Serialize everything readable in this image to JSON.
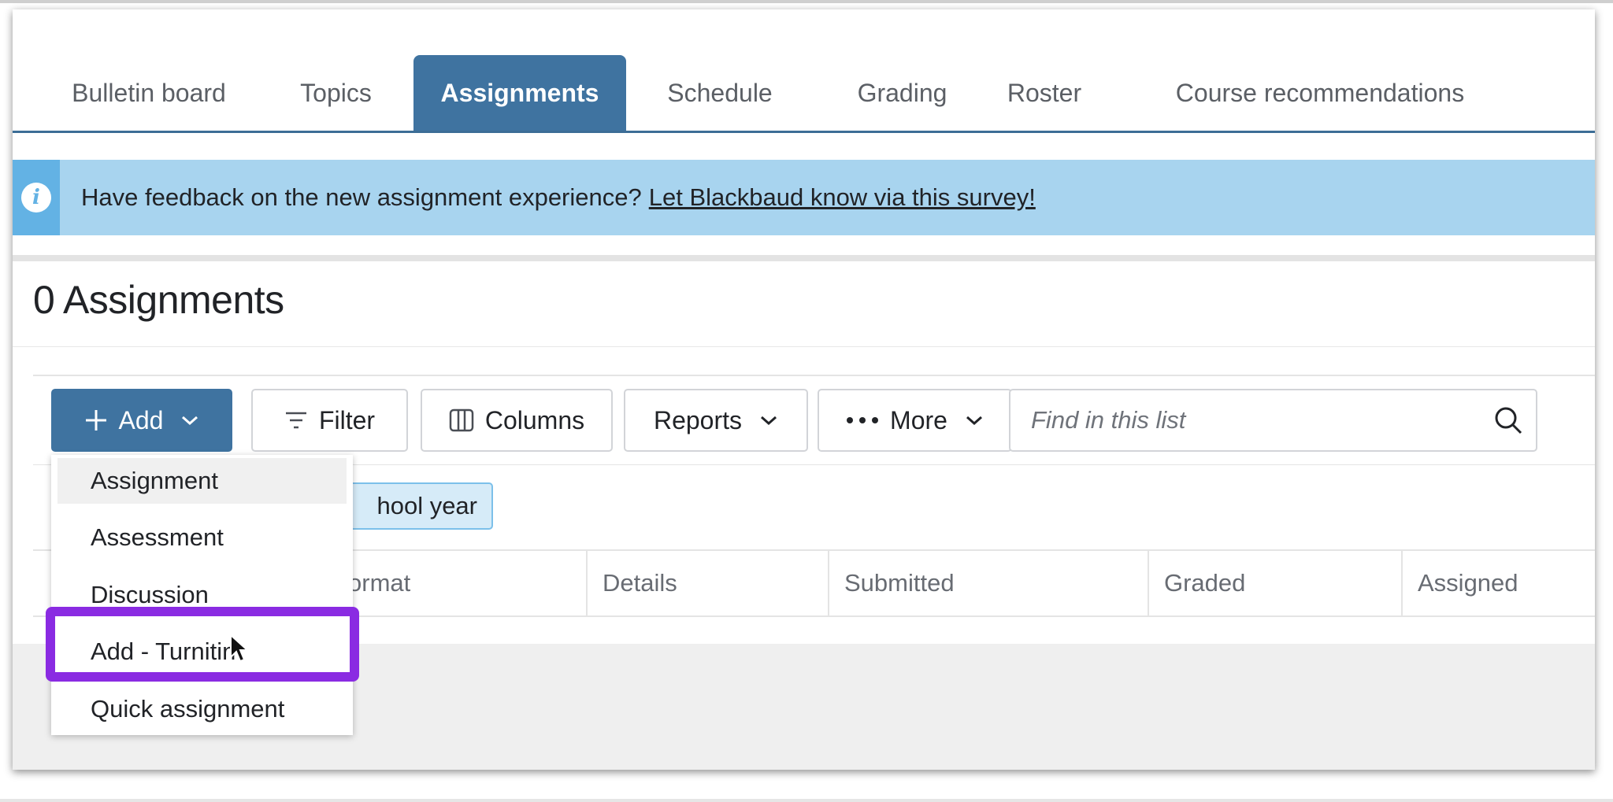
{
  "tabs": [
    {
      "label": "Bulletin board",
      "active": false
    },
    {
      "label": "Topics",
      "active": false
    },
    {
      "label": "Assignments",
      "active": true
    },
    {
      "label": "Schedule",
      "active": false
    },
    {
      "label": "Grading",
      "active": false
    },
    {
      "label": "Roster",
      "active": false
    },
    {
      "label": "Course recommendations",
      "active": false
    }
  ],
  "banner": {
    "text": "Have feedback on the new assignment experience?",
    "link": "Let Blackbaud know via this survey!",
    "icon": "info-icon"
  },
  "page_title": "0 Assignments",
  "toolbar": {
    "add_label": "Add",
    "filter_label": "Filter",
    "columns_label": "Columns",
    "reports_label": "Reports",
    "more_label": "More",
    "search_placeholder": "Find in this list"
  },
  "filter_chip": "hool year",
  "table_headers": [
    "ormat",
    "Details",
    "Submitted",
    "Graded",
    "Assigned"
  ],
  "add_menu": {
    "items": [
      "Assignment",
      "Assessment",
      "Discussion",
      "Add - Turnitin",
      "Quick assignment"
    ],
    "hovered_index": 0,
    "highlighted_index": 3
  },
  "colors": {
    "accent": "#3f73a0",
    "banner": "#a8d4ef",
    "highlight": "#8a2be2"
  }
}
